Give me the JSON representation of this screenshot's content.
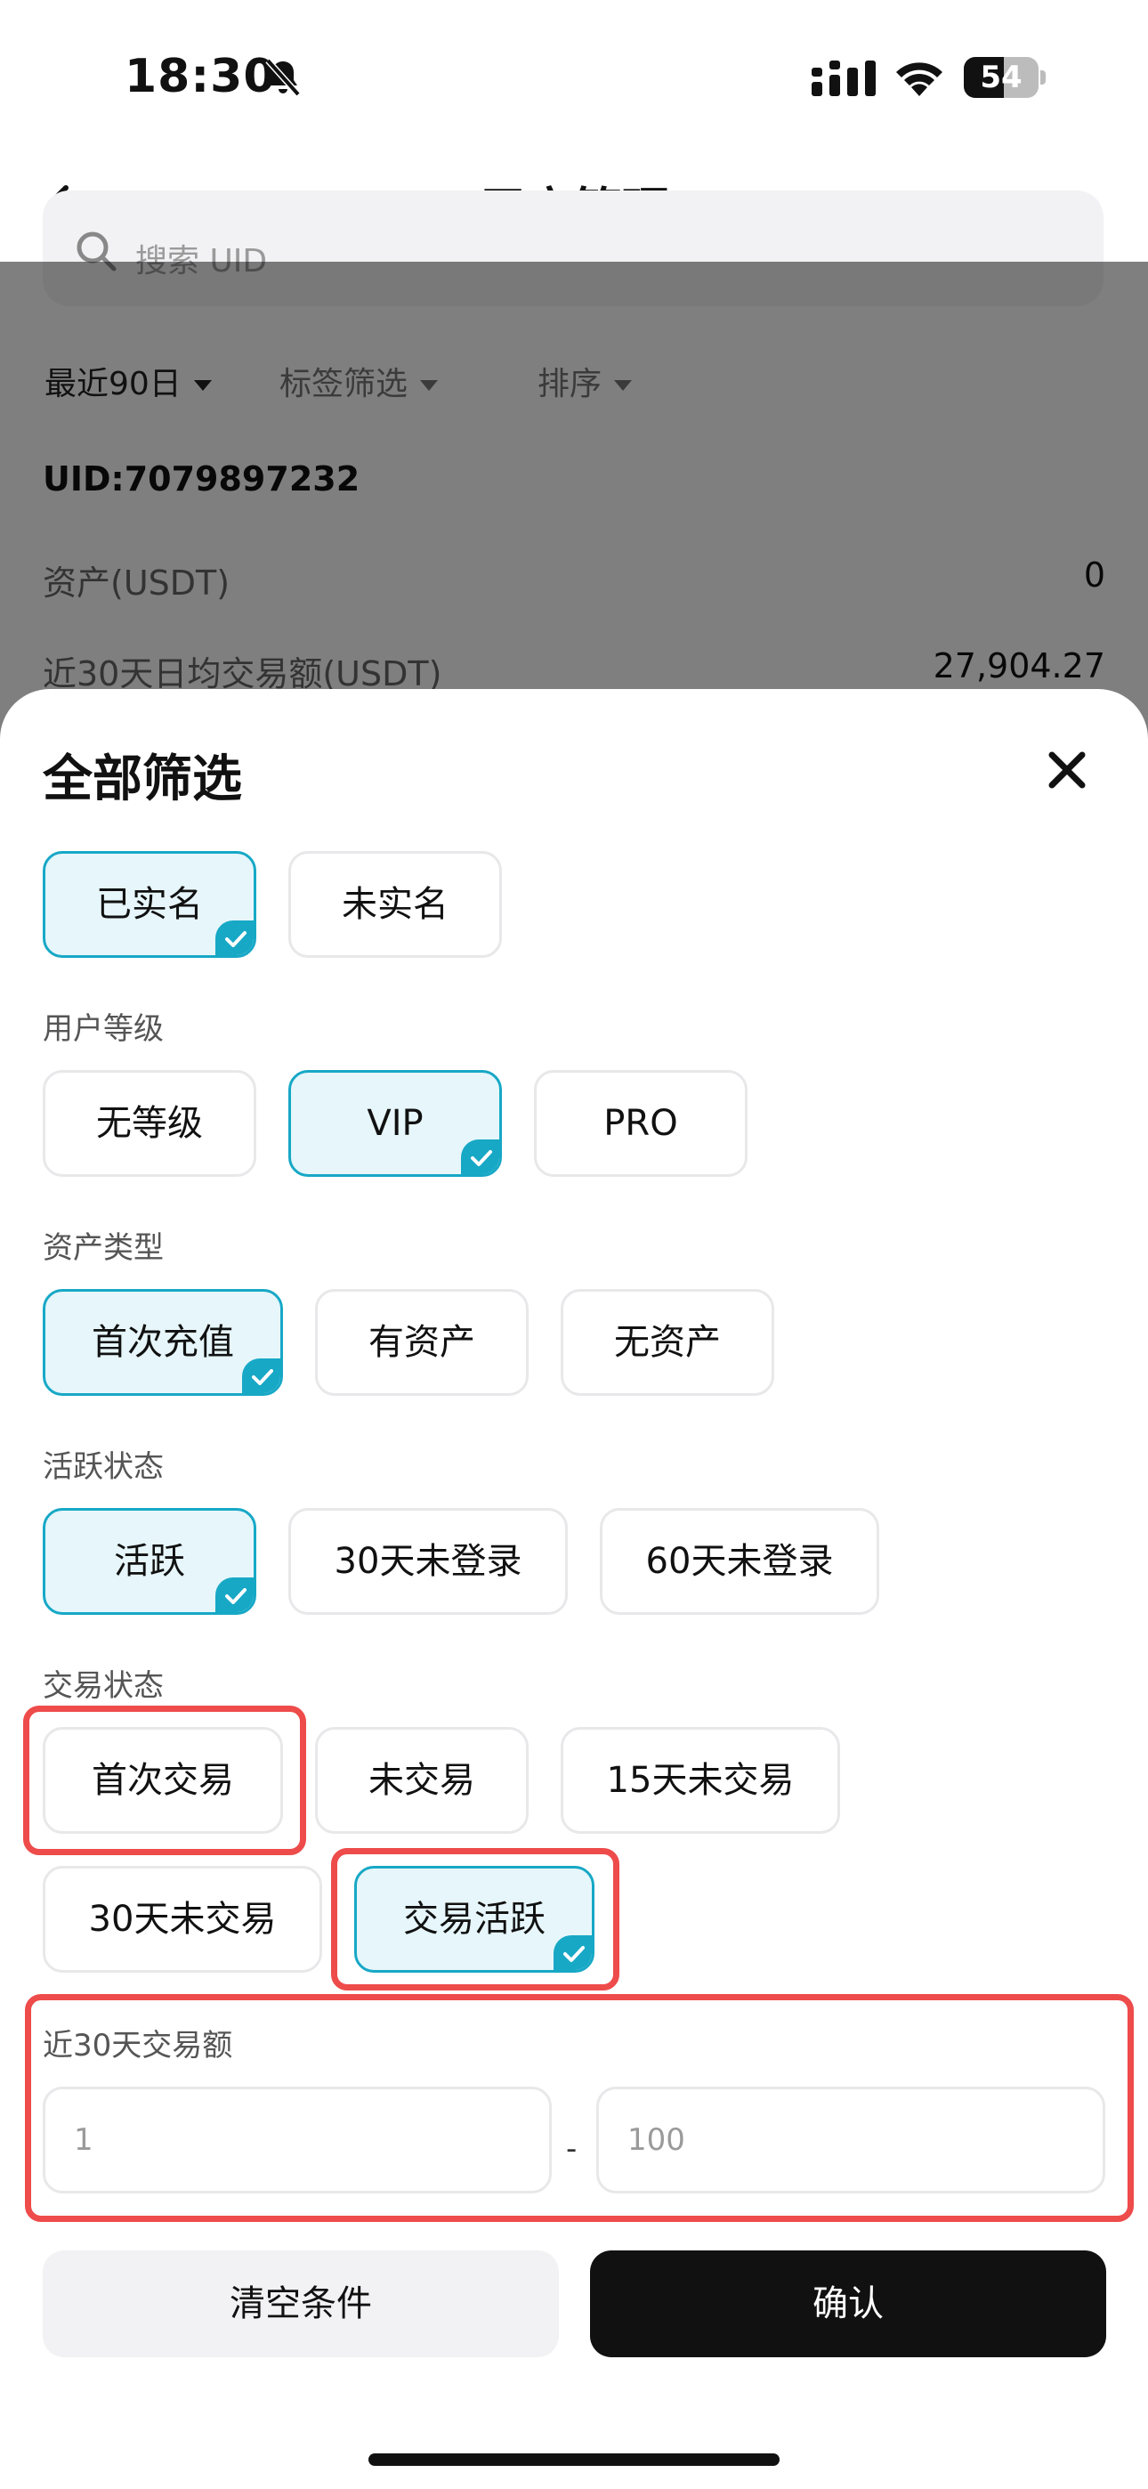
{
  "status_bar": {
    "time": "18:30",
    "battery": "54",
    "battery_level": 0.54,
    "icons": [
      "bell-slash-icon",
      "signal-icon",
      "wifi-icon",
      "battery-icon"
    ]
  },
  "nav": {
    "title": "用户管理",
    "back_icon": "arrow-left-icon",
    "more_icon": "more-icon"
  },
  "background": {
    "search_placeholder": "搜索 UID",
    "filters": [
      "最近90日",
      "标签筛选",
      "排序"
    ],
    "uid": "UID:7079897232",
    "rows": [
      {
        "label": "资产(USDT)",
        "value": "0"
      },
      {
        "label": "近30天日均交易额(USDT)",
        "value": "27,904.27"
      }
    ]
  },
  "sheet": {
    "title": "全部筛选",
    "verification": [
      {
        "label": "已实名",
        "selected": true
      },
      {
        "label": "未实名",
        "selected": false
      }
    ],
    "level": {
      "title": "用户等级",
      "options": [
        {
          "label": "无等级",
          "selected": false
        },
        {
          "label": "VIP",
          "selected": true
        },
        {
          "label": "PRO",
          "selected": false
        }
      ]
    },
    "asset_type": {
      "title": "资产类型",
      "options": [
        {
          "label": "首次充值",
          "selected": true
        },
        {
          "label": "有资产",
          "selected": false
        },
        {
          "label": "无资产",
          "selected": false
        }
      ]
    },
    "activity": {
      "title": "活跃状态",
      "options": [
        {
          "label": "活跃",
          "selected": true
        },
        {
          "label": "30天未登录",
          "selected": false
        },
        {
          "label": "60天未登录",
          "selected": false
        }
      ]
    },
    "trading": {
      "title": "交易状态",
      "options": [
        {
          "label": "首次交易",
          "selected": false
        },
        {
          "label": "未交易",
          "selected": false
        },
        {
          "label": "15天未交易",
          "selected": false
        },
        {
          "label": "30天未交易",
          "selected": false
        },
        {
          "label": "交易活跃",
          "selected": true
        }
      ]
    },
    "volume": {
      "title": "近30天交易额",
      "min_placeholder": "1",
      "separator": "-",
      "max_placeholder": "100"
    },
    "buttons": {
      "clear": "清空条件",
      "confirm": "确认"
    }
  },
  "colors": {
    "accent": "#17a8c6",
    "selected_bg": "#e6f6fa",
    "highlight": "#ee4b4b",
    "confirm_bg": "#111111"
  }
}
